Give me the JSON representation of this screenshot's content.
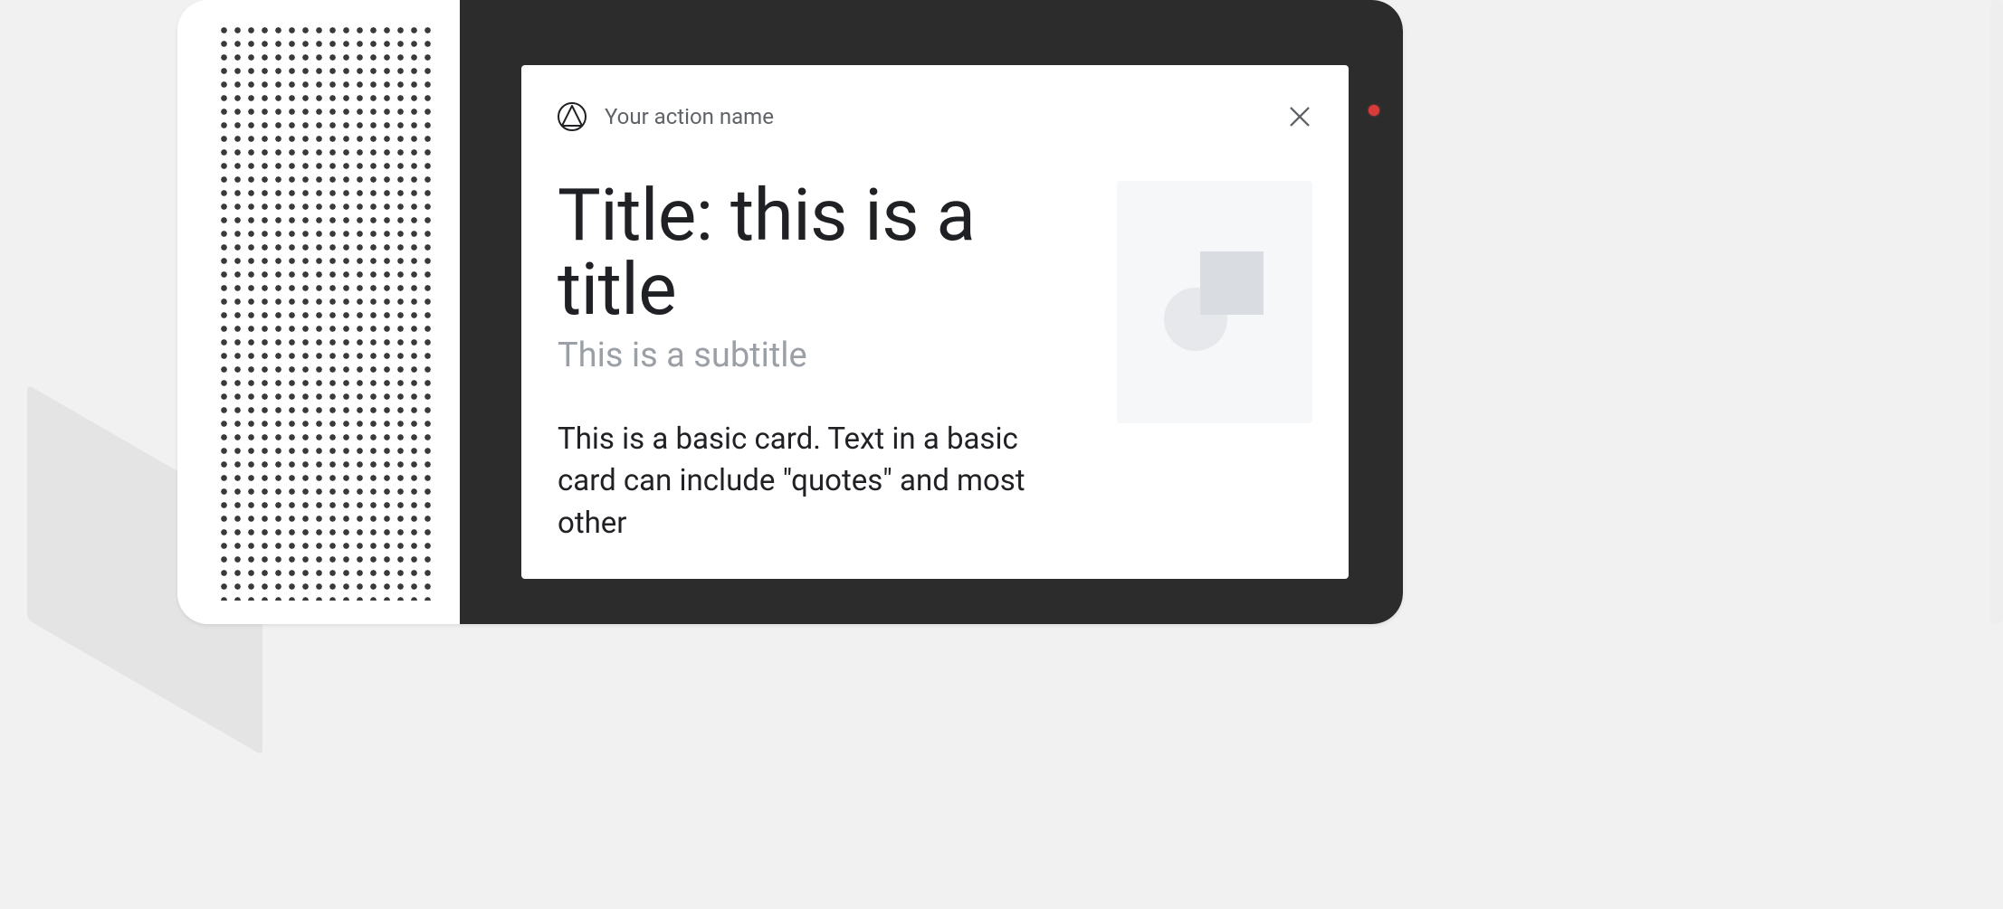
{
  "header": {
    "action_name": "Your action name"
  },
  "card": {
    "title": "Title: this is a title",
    "subtitle": "This is a subtitle",
    "body": "This is a basic card. Text in a basic card can include \"quotes\" and most other"
  },
  "icons": {
    "logo": "material-logo-icon",
    "close": "close-icon",
    "image_placeholder": "image-placeholder-icon",
    "led": "status-led"
  }
}
